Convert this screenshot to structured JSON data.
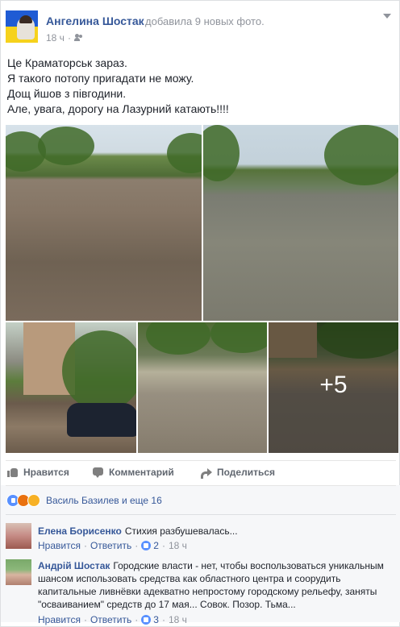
{
  "post": {
    "author": "Ангелина Шостак",
    "action": "добавила 9 новых фото.",
    "time": "18 ч",
    "audience_icon": "friends-icon",
    "lines": [
      "Це Краматорськ зараз.",
      "Я такого потопу пригадати не можу.",
      "Дощ йшов з півгодини.",
      "Але, увага, дорогу на Лазурний катають!!!!"
    ]
  },
  "photos": {
    "more_label": "+5"
  },
  "actions": {
    "like": "Нравится",
    "comment": "Комментарий",
    "share": "Поделиться"
  },
  "reactions": {
    "names": "Василь Базилев и еще 16",
    "icons": [
      "like-reaction-icon",
      "angry-reaction-icon",
      "wow-reaction-icon"
    ]
  },
  "comments": [
    {
      "author": "Елена Борисенко",
      "text": "Стихия разбушевалась...",
      "like": "Нравится",
      "reply": "Ответить",
      "likes": "2",
      "time": "18 ч"
    },
    {
      "author": "Андрій Шостак",
      "lines": [
        "Городские власти - нет, чтобы воспользоваться уникальным",
        "шансом использовать средства как областного центра и соорудить",
        "капитальные ливнёвки адекватно непростому городскому рельефу, заняты",
        "\"осваиванием\" средств до 17 мая... Совок. Позор. Тьма..."
      ],
      "like": "Нравится",
      "reply": "Ответить",
      "likes": "3",
      "time": "18 ч"
    }
  ],
  "colors": {
    "link": "#365899",
    "muted": "#90949c",
    "text": "#1d2129",
    "like_blue": "#5890ff"
  }
}
